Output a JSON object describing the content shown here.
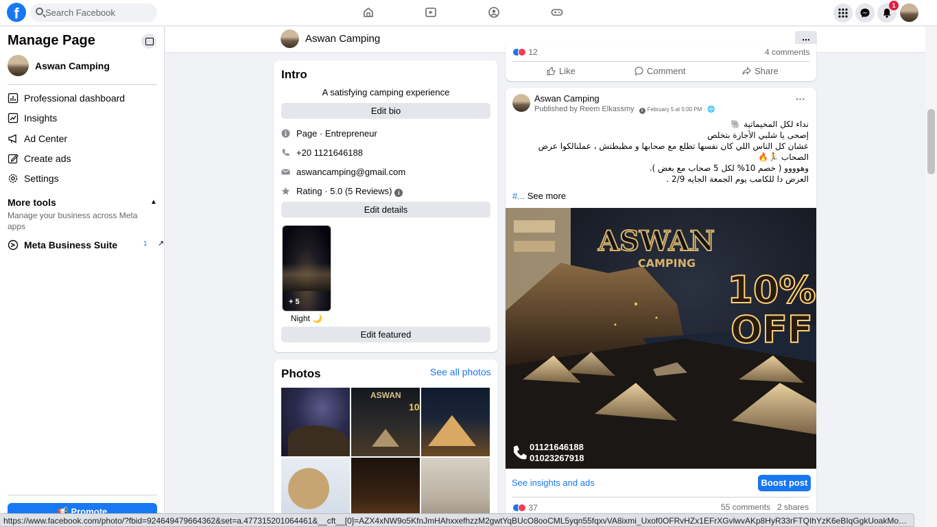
{
  "topbar": {
    "logo": "f",
    "search_placeholder": "Search Facebook",
    "nav_icons": [
      "home-icon",
      "video-icon",
      "groups-icon",
      "gaming-icon"
    ],
    "right_icons": [
      "menu-grid-icon",
      "messenger-icon",
      "bell-icon"
    ],
    "notification_count": "1",
    "accent": "#1877f2"
  },
  "sidebar": {
    "title": "Manage Page",
    "page_name": "Aswan Camping",
    "items": [
      {
        "label": "Professional dashboard",
        "icon": "dashboard-icon"
      },
      {
        "label": "Insights",
        "icon": "insights-icon"
      },
      {
        "label": "Ad Center",
        "icon": "megaphone-icon"
      },
      {
        "label": "Create ads",
        "icon": "pencil-icon"
      },
      {
        "label": "Settings",
        "icon": "gear-icon"
      }
    ],
    "more_tools": "More tools",
    "more_tools_desc": "Manage your business across Meta apps",
    "business_suite": "Meta Business Suite",
    "business_suite_badge": "1",
    "promote": "Promote"
  },
  "pagebar": {
    "name": "Aswan Camping",
    "more": "..."
  },
  "intro": {
    "title": "Intro",
    "bio": "A satisfying camping experience",
    "edit_bio": "Edit bio",
    "category": "Page · Entrepreneur",
    "phone": "+20 1121646188",
    "email": "aswancamping@gmail.com",
    "rating": "Rating · 5.0 (5 Reviews)",
    "edit_details": "Edit details",
    "featured_count": "+ 5",
    "featured_label": "Night 🌙",
    "edit_featured": "Edit featured"
  },
  "photos": {
    "title": "Photos",
    "see_all": "See all photos"
  },
  "prev_post": {
    "reactions_count": "12",
    "comments": "4 comments",
    "like": "Like",
    "comment": "Comment",
    "share": "Share"
  },
  "post": {
    "page_name": "Aswan Camping",
    "published_by": "Published by Reem Elkassmy",
    "date": "February 5 at 5:00 PM ·",
    "lines": [
      "نداء لكل المخيماتية 🐘",
      "إصحى يا شلبي الأجازة بتخلص",
      "عشان كل الناس اللي كان نفسها تطلع مع صحابها و مظبطتش ، عملنالكوا عرض",
      "الصحاب 🏃🔥",
      "وهوووو  ( خصم 10% لكل 5 صحاب مع بعض ).",
      "العرض دا للكامب يوم الجمعة الجايه 2/9 ."
    ],
    "hash": "#...",
    "see_more": "See more",
    "image": {
      "brand": "ASWAN",
      "brand_sub": "CAMPING",
      "discount_top": "10%",
      "discount_bottom": "OFF",
      "phone1": "01121646188",
      "phone2": "01023267918"
    },
    "insights": "See insights and ads",
    "boost": "Boost post",
    "reactions_count": "37",
    "comments": "55 comments",
    "shares": "2 shares"
  },
  "status_url": "https://www.facebook.com/photo/?fbid=924649479664362&set=a.477315201064461&__cft__[0]=AZX4xNW9o5KfnJmHAhxxefhzzM2gwtYqBUcO8ooCML5yqn55fqxvVA8ixmi_Uxof0OFRvHZx1EFrXGvlwvAKp8HyR33rFTQIhYzK6eBIqGgkUoakMoGQQ9p..."
}
